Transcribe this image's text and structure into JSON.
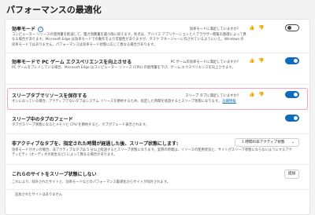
{
  "page": {
    "title": "パフォーマンスの最適化"
  },
  "efficiency": {
    "title": "効率モード",
    "help_icon": "?",
    "feedback": "効率モードに満足していますか?",
    "toggle_on": false,
    "desc": "コンピューター リソースの使用量を削減して、電力消費量を最小限に抑えます。利点は、デバイス アプリケーションと人ブラウザー閲覧の基礎によって異なる場合があります。Microsoft Edge は効率モードでの動作をより可能性がありますが、タスク マネージャーに作されているようにいえ。Windows の効率モードではありません。パフォーマンスは効率モード状態に応じて異なる場合があります。"
  },
  "gaming": {
    "title": "効率モードで PC ゲーム エクスペリエンスを向上させる",
    "feedback": "PC ゲームの効率モードに満足していますか?",
    "toggle_on": true,
    "desc": "PC ゲームをプレイしている場合、Microsoft Edge はコンピューター リソース (CPU) の使用量を下げ、ゲーム エクスペリエンスを向上させます。"
  },
  "sleeping": {
    "title": "スリープタブでリソースを保存する",
    "feedback": "スリープ タブに満足していますか?",
    "toggle_on": true,
    "desc": "オンになっている場合、アクティブでないタブはシステム リソースを節約するため、指定した時間を経過するとスリープ状態になります。",
    "link": "詳細情報"
  },
  "fade": {
    "title": "スリープ中のタブのフェード",
    "toggle_on": true,
    "desc": "タブがスリープ状態になるとメモリと CPU を節約すると、タブがフェード表示されます。"
  },
  "inactive": {
    "title": "非アクティブなタブを、指定された時間が経過した後、スリープ状態にします:",
    "dropdown_value": "1 時間の非アクティブ状態",
    "chevron": "⌄",
    "desc": "効率モードがオンの場合、非アクティブなタブは 5 分以上経過するとスリープ状態になります。実際の時間は、リソースの使用状況と、サイトがスリープ状態にならないようにするアクティビティ (オーディオの再生など) によって異なる場合があります。"
  },
  "never": {
    "title": "これらのサイトをスリープ状態にしない",
    "add_label": "追加",
    "desc": "これにより、除外されたサイトと、効率モードなどのパフォーマンス最適化からサイトが除外されます。",
    "empty_text": "追加されたサイトはありません"
  }
}
